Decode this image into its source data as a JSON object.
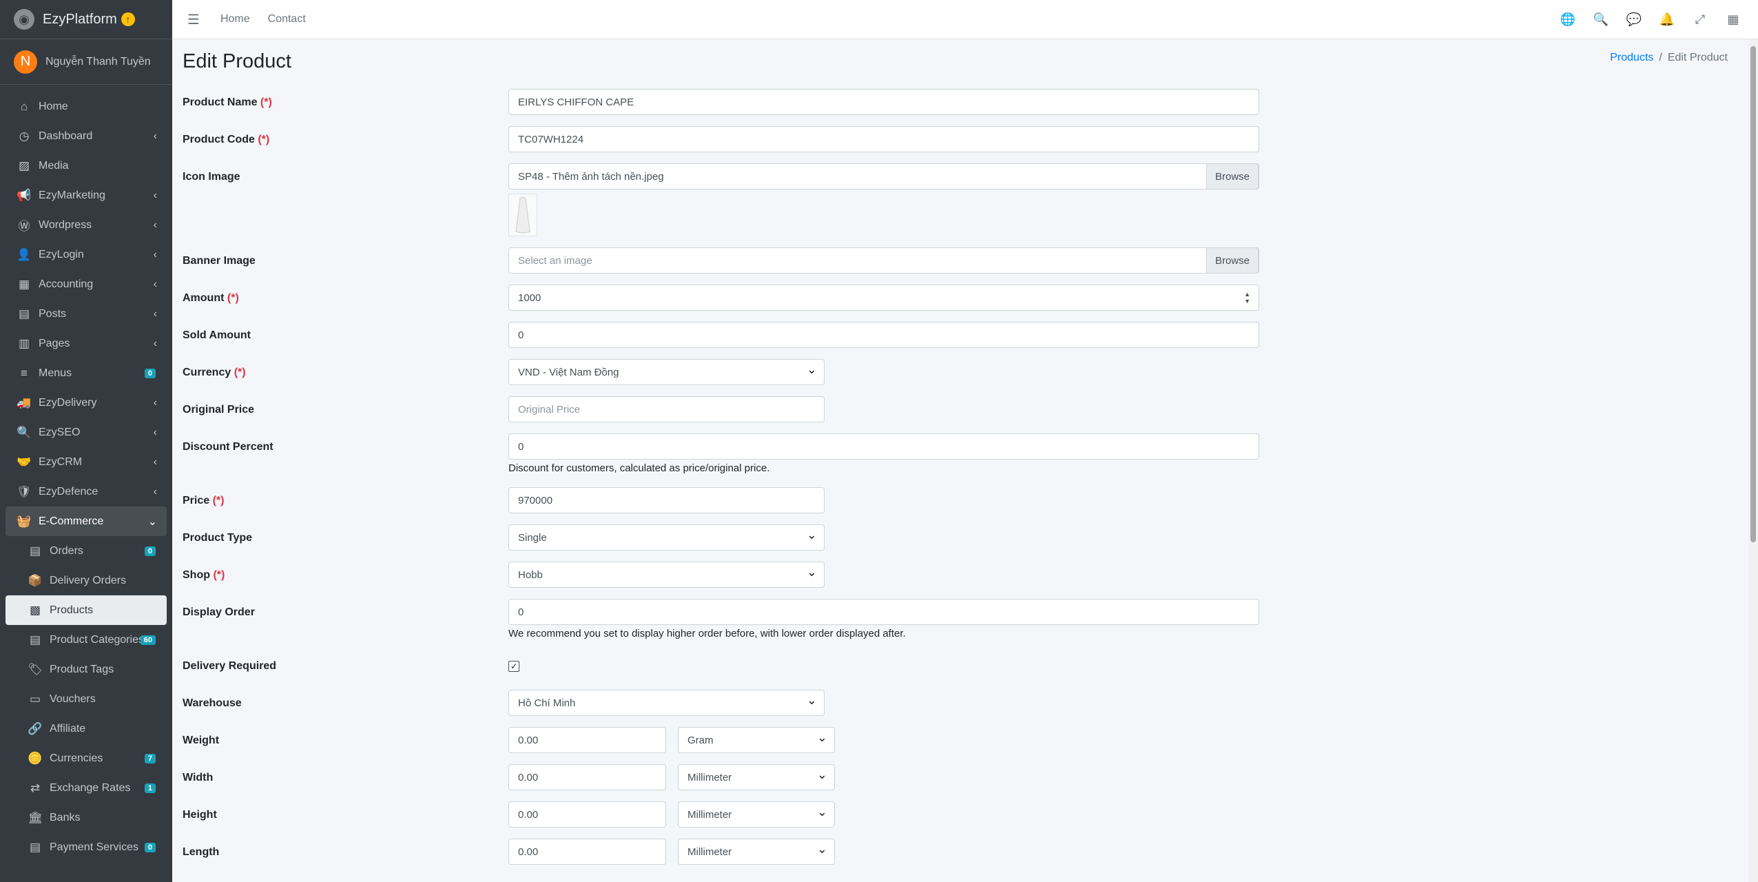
{
  "brand": {
    "name": "EzyPlatform"
  },
  "user": {
    "initial": "N",
    "name": "Nguyễn Thanh Tuyền"
  },
  "header": {
    "links": [
      "Home",
      "Contact"
    ]
  },
  "sidebar": {
    "items": [
      {
        "label": "Home",
        "icon": "home-icon",
        "glyph": "⌂"
      },
      {
        "label": "Dashboard",
        "icon": "dashboard-icon",
        "glyph": "◷",
        "chev": "‹"
      },
      {
        "label": "Media",
        "icon": "image-icon",
        "glyph": "▨"
      },
      {
        "label": "EzyMarketing",
        "icon": "megaphone-icon",
        "glyph": "📢",
        "chev": "‹"
      },
      {
        "label": "Wordpress",
        "icon": "wordpress-icon",
        "glyph": "Ⓦ",
        "chev": "‹"
      },
      {
        "label": "EzyLogin",
        "icon": "user-lock-icon",
        "glyph": "👤",
        "chev": "‹"
      },
      {
        "label": "Accounting",
        "icon": "calculator-icon",
        "glyph": "▦",
        "chev": "‹"
      },
      {
        "label": "Posts",
        "icon": "newspaper-icon",
        "glyph": "▤",
        "chev": "‹"
      },
      {
        "label": "Pages",
        "icon": "columns-icon",
        "glyph": "▥",
        "chev": "‹"
      },
      {
        "label": "Menus",
        "icon": "bars-icon",
        "glyph": "≡",
        "badge": "0"
      },
      {
        "label": "EzyDelivery",
        "icon": "truck-icon",
        "glyph": "🚚",
        "chev": "‹"
      },
      {
        "label": "EzySEO",
        "icon": "search-icon",
        "glyph": "🔍",
        "chev": "‹"
      },
      {
        "label": "EzyCRM",
        "icon": "handshake-icon",
        "glyph": "🤝",
        "chev": "‹"
      },
      {
        "label": "EzyDefence",
        "icon": "shield-icon",
        "glyph": "🛡",
        "chev": "‹"
      },
      {
        "label": "E-Commerce",
        "icon": "basket-icon",
        "glyph": "🧺",
        "chev": "⌄",
        "open": true
      }
    ],
    "subitems": [
      {
        "label": "Orders",
        "icon": "receipt-icon",
        "glyph": "▤",
        "badge": "0"
      },
      {
        "label": "Delivery Orders",
        "icon": "dolly-icon",
        "glyph": "📦"
      },
      {
        "label": "Products",
        "icon": "boxes-icon",
        "glyph": "▩",
        "active": true
      },
      {
        "label": "Product Categories",
        "icon": "list-icon",
        "glyph": "▤",
        "badge": "60"
      },
      {
        "label": "Product Tags",
        "icon": "tags-icon",
        "glyph": "🏷"
      },
      {
        "label": "Vouchers",
        "icon": "ticket-icon",
        "glyph": "▭"
      },
      {
        "label": "Affiliate",
        "icon": "link-icon",
        "glyph": "🔗"
      },
      {
        "label": "Currencies",
        "icon": "coins-icon",
        "glyph": "🪙",
        "badge": "7"
      },
      {
        "label": "Exchange Rates",
        "icon": "exchange-icon",
        "glyph": "⇄",
        "badge": "1"
      },
      {
        "label": "Banks",
        "icon": "bank-icon",
        "glyph": "🏛"
      },
      {
        "label": "Payment Services",
        "icon": "server-icon",
        "glyph": "▤",
        "badge": "0"
      }
    ]
  },
  "page": {
    "title": "Edit Product",
    "breadcrumb": {
      "link": "Products",
      "separator": "/",
      "current": "Edit Product"
    }
  },
  "required_mark": "(*)",
  "form": {
    "product_name": {
      "label": "Product Name",
      "value": "EIRLYS CHIFFON CAPE"
    },
    "product_code": {
      "label": "Product Code",
      "value": "TC07WH1224"
    },
    "icon_image": {
      "label": "Icon Image",
      "value": "SP48 - Thêm ảnh tách nền.jpeg",
      "browse": "Browse"
    },
    "banner_image": {
      "label": "Banner Image",
      "placeholder": "Select an image",
      "browse": "Browse"
    },
    "amount": {
      "label": "Amount",
      "value": "1000"
    },
    "sold_amount": {
      "label": "Sold Amount",
      "value": "0"
    },
    "currency": {
      "label": "Currency",
      "value": "VND - Việt Nam Đồng"
    },
    "original_price": {
      "label": "Original Price",
      "placeholder": "Original Price"
    },
    "discount_percent": {
      "label": "Discount Percent",
      "value": "0",
      "help": "Discount for customers, calculated as price/original price."
    },
    "price": {
      "label": "Price",
      "value": "970000"
    },
    "product_type": {
      "label": "Product Type",
      "value": "Single"
    },
    "shop": {
      "label": "Shop",
      "value": "Hobb"
    },
    "display_order": {
      "label": "Display Order",
      "value": "0",
      "help": "We recommend you set to display higher order before, with lower order displayed after."
    },
    "delivery_required": {
      "label": "Delivery Required",
      "checked": true
    },
    "warehouse": {
      "label": "Warehouse",
      "value": "Hồ Chí Minh"
    },
    "weight": {
      "label": "Weight",
      "value": "0.00",
      "unit": "Gram"
    },
    "width": {
      "label": "Width",
      "value": "0.00",
      "unit": "Millimeter"
    },
    "height": {
      "label": "Height",
      "value": "0.00",
      "unit": "Millimeter"
    },
    "length": {
      "label": "Length",
      "value": "0.00",
      "unit": "Millimeter"
    }
  }
}
